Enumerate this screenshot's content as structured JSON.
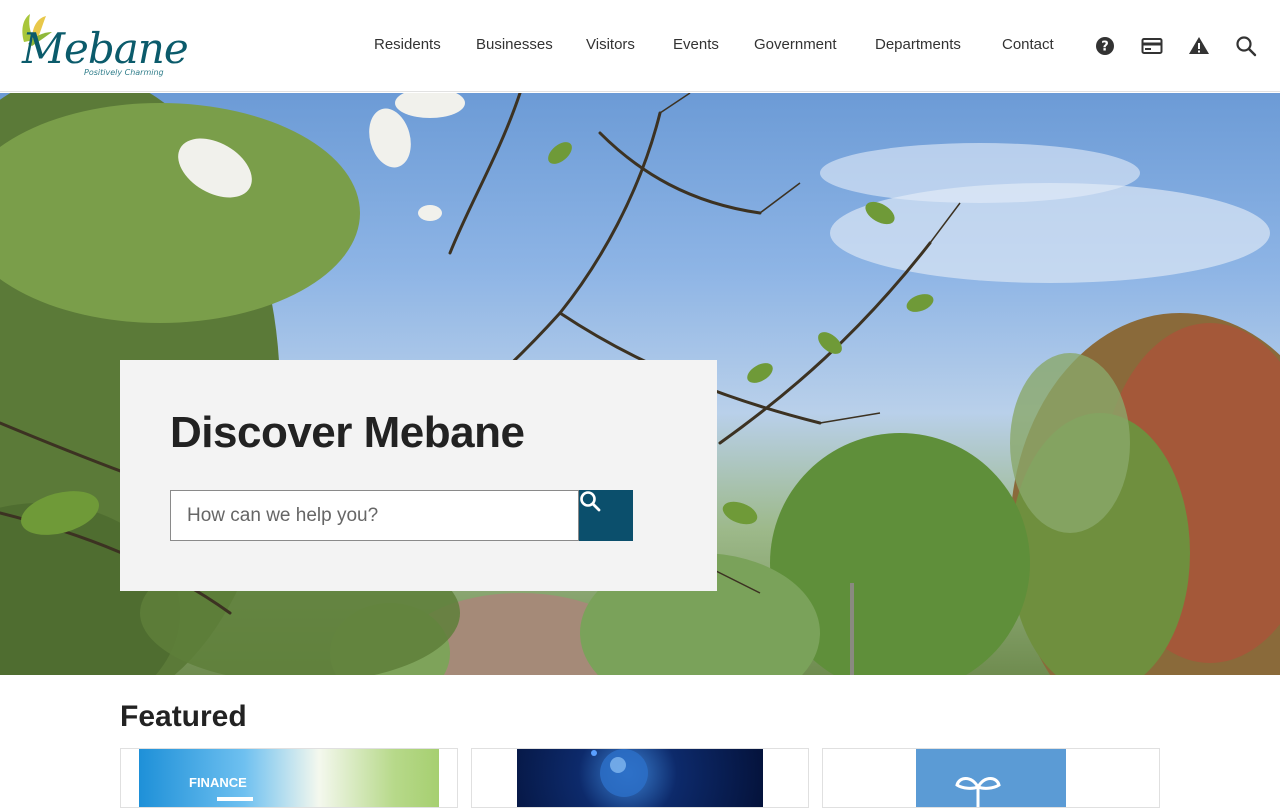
{
  "site": {
    "logo_text": "Mebane",
    "logo_tagline": "Positively Charming"
  },
  "nav": {
    "items": [
      {
        "label": "Residents"
      },
      {
        "label": "Businesses"
      },
      {
        "label": "Visitors"
      },
      {
        "label": "Events"
      },
      {
        "label": "Government"
      },
      {
        "label": "Departments"
      },
      {
        "label": "Contact"
      }
    ]
  },
  "toolbar": {
    "icons": [
      "help-icon",
      "payment-card-icon",
      "alert-icon",
      "search-icon"
    ]
  },
  "hero": {
    "title": "Discover Mebane",
    "search_placeholder": "How can we help you?"
  },
  "featured": {
    "heading": "Featured",
    "cards": [
      {
        "label": "FINANCE"
      },
      {
        "label": ""
      },
      {
        "label": ""
      }
    ]
  },
  "colors": {
    "brand": "#0b5b6b",
    "search_button": "#0b4f6c"
  }
}
